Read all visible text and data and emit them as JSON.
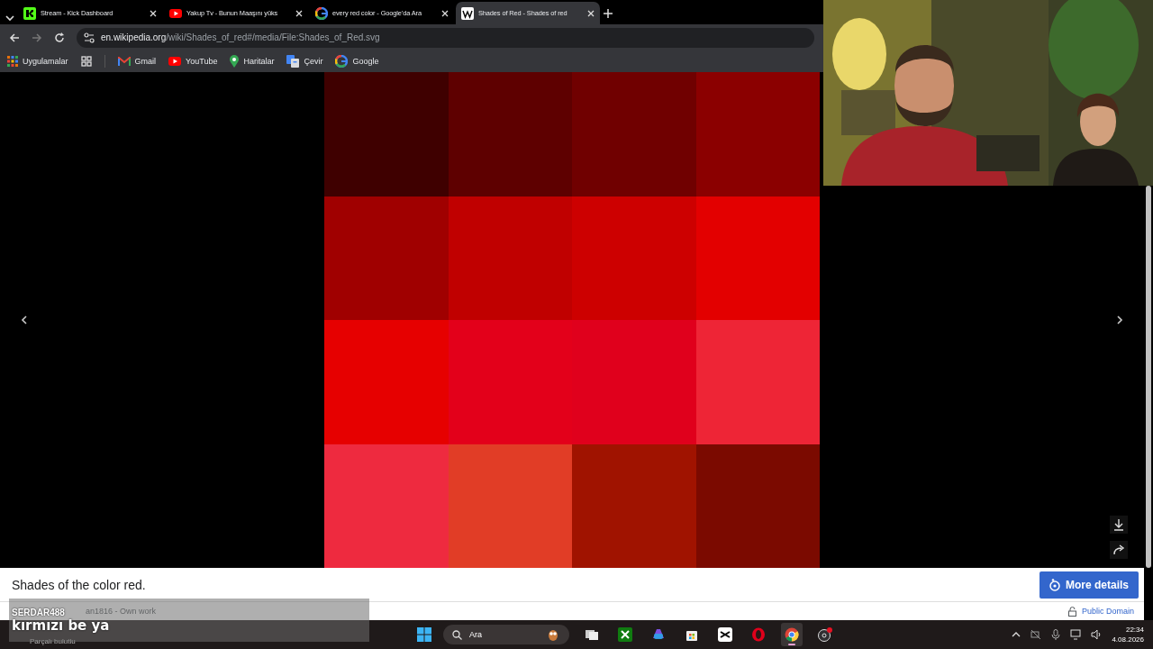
{
  "tabs": [
    {
      "title": "Stream - Kick Dashboard",
      "kind": "kick",
      "selected": false
    },
    {
      "title": "Yakup Tv - Bunun Maaşını yüks",
      "kind": "youtube",
      "selected": false
    },
    {
      "title": "every red color - Google'da Ara",
      "kind": "google",
      "selected": false
    },
    {
      "title": "Shades of Red - Shades of red",
      "kind": "wikipedia",
      "selected": true
    }
  ],
  "address": {
    "host": "en.wikipedia.org",
    "path": "/wiki/Shades_of_red#/media/File:Shades_of_Red.svg"
  },
  "bookmarks": [
    {
      "label": "Uygulamalar",
      "kind": "apps"
    },
    {
      "label": "Gmail",
      "kind": "gmail"
    },
    {
      "label": "YouTube",
      "kind": "youtube"
    },
    {
      "label": "Haritalar",
      "kind": "maps"
    },
    {
      "label": "Çevir",
      "kind": "translate"
    },
    {
      "label": "Google",
      "kind": "google"
    }
  ],
  "viewer": {
    "swatches": [
      {
        "color": "#3f0000"
      },
      {
        "color": "#5e0000"
      },
      {
        "color": "#700000"
      },
      {
        "color": "#8b0000"
      },
      {
        "color": "#a00000"
      },
      {
        "color": "#c00000"
      },
      {
        "color": "#cd0000"
      },
      {
        "color": "#e30000"
      },
      {
        "color": "#e60000"
      },
      {
        "color": "#e3001a"
      },
      {
        "color": "#e0001c"
      },
      {
        "color": "#ee2536"
      },
      {
        "color": "#ee2a3f"
      },
      {
        "color": "#e13d26"
      },
      {
        "color": "#a01300"
      },
      {
        "color": "#7b0a00"
      }
    ]
  },
  "file_info": {
    "caption": "Shades of the color red.",
    "button": "More details",
    "credit": "an1816 - Own work",
    "license": "Public Domain"
  },
  "chat": {
    "user": "SERDAR488",
    "message": "kırmızı be ya"
  },
  "taskbar": {
    "weather": "Parçalı bulutlu",
    "search": "Ara",
    "apps": [
      {
        "kind": "taskview",
        "active": false
      },
      {
        "kind": "xbox",
        "active": false
      },
      {
        "kind": "m365",
        "active": false
      },
      {
        "kind": "store",
        "active": false
      },
      {
        "kind": "capcut",
        "active": false
      },
      {
        "kind": "opera",
        "active": false
      },
      {
        "kind": "chrome",
        "active": true
      },
      {
        "kind": "obs",
        "active": false
      }
    ],
    "time": "22:34",
    "date": "4.08.2026"
  }
}
